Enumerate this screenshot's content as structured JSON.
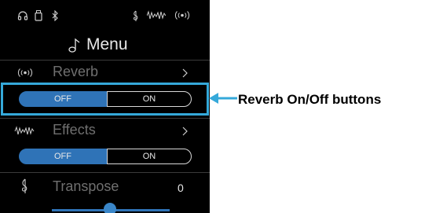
{
  "status_bar": {
    "icons": [
      "headphones-icon",
      "usb-drive-icon",
      "bluetooth-icon",
      "transpose-clef-icon",
      "effects-waveform-icon",
      "reverb-waves-icon"
    ]
  },
  "menu": {
    "title": "Menu",
    "title_icon": "music-note-icon",
    "rows": [
      {
        "label": "Reverb",
        "icon": "reverb-waves-icon",
        "has_submenu": true,
        "toggle": {
          "off_label": "OFF",
          "on_label": "ON",
          "selected": "OFF"
        }
      },
      {
        "label": "Effects",
        "icon": "effects-waveform-icon",
        "has_submenu": true,
        "toggle": {
          "off_label": "OFF",
          "on_label": "ON",
          "selected": "OFF"
        }
      },
      {
        "label": "Transpose",
        "icon": "treble-clef-icon",
        "value": "0"
      }
    ]
  },
  "annotation": {
    "text": "Reverb On/Off buttons",
    "highlight_color": "#35a9da"
  },
  "colors": {
    "screen_bg": "#000000",
    "accent_blue": "#2f73b7",
    "label_gray": "#6f6f6f",
    "text_light": "#e8e8e8"
  }
}
